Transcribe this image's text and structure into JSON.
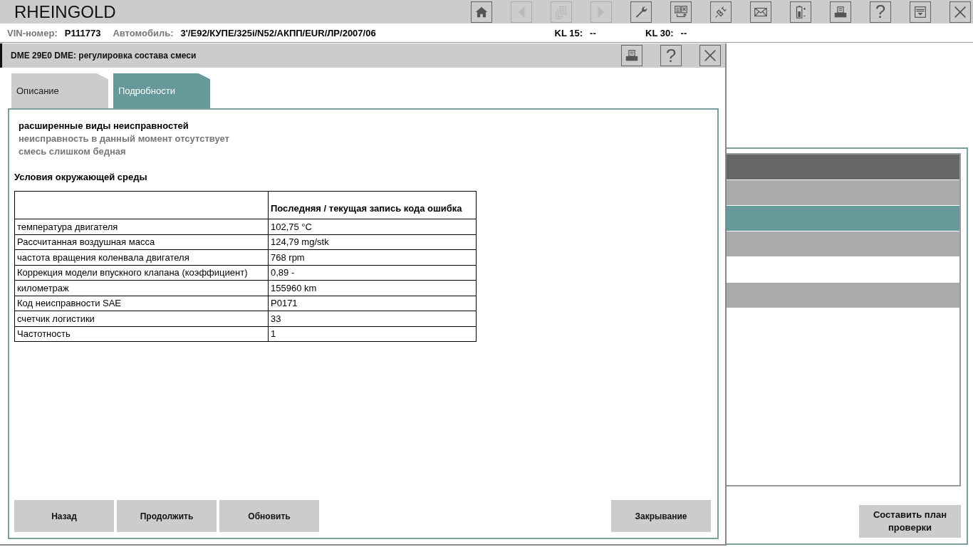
{
  "app": {
    "title": "RHEINGOLD"
  },
  "toolbar": [
    {
      "kind": "home",
      "disabled": false
    },
    {
      "kind": "back",
      "disabled": true
    },
    {
      "kind": "documents",
      "disabled": true
    },
    {
      "kind": "forward",
      "disabled": true
    },
    {
      "kind": "wrench",
      "disabled": false
    },
    {
      "kind": "swap",
      "disabled": false
    },
    {
      "kind": "plug",
      "disabled": false
    },
    {
      "kind": "envelope",
      "disabled": false
    },
    {
      "kind": "battery",
      "disabled": false
    },
    {
      "kind": "printer",
      "disabled": false
    },
    {
      "kind": "help",
      "label": "?",
      "disabled": false
    },
    {
      "kind": "dropdown",
      "disabled": false
    },
    {
      "kind": "close",
      "disabled": false
    }
  ],
  "vehicle_bar": {
    "vin_label": "VIN-номер:",
    "vin": "P111773",
    "car_label": "Автомобиль:",
    "car": "3'/E92/КУПЕ/325i/N52/АКПП/EUR/ЛР/2007/06",
    "kl15_label": "KL 15:",
    "kl15": "--",
    "kl30_label": "KL 30:",
    "kl30": "--"
  },
  "background_panel": {
    "rows": [
      {
        "color": "#666666"
      },
      {
        "color": "#aaaaaa"
      },
      {
        "color": "#669999"
      },
      {
        "color": "#aaaaaa"
      },
      {
        "color": "#aaaaaa"
      }
    ],
    "button": "Составить план проверки"
  },
  "dialog": {
    "title": "DME 29E0 DME: регулировка состава смеси",
    "title_buttons": [
      {
        "kind": "printer"
      },
      {
        "kind": "help",
        "label": "?"
      },
      {
        "kind": "close"
      }
    ],
    "tabs": [
      {
        "label": "Описание",
        "selected": false
      },
      {
        "label": "Подробности",
        "selected": true
      }
    ],
    "fault_types_heading": "расширенные виды неисправностей",
    "fault_types": [
      "неисправность в данный момент отсутствует",
      "смесь слишком бедная"
    ],
    "environment_heading": "Условия окружающей среды",
    "table": {
      "column_2_header": "Последняя / текущая запись кода ошибка",
      "rows": [
        [
          "температура двигателя",
          "102,75 °C"
        ],
        [
          "Рассчитанная воздушная масса",
          "124,79 mg/stk"
        ],
        [
          "частота вращения коленвала двигателя",
          "768 rpm"
        ],
        [
          "Коррекция модели впускного клапана (коэффициент)",
          "0,89 -"
        ],
        [
          "километраж",
          "155960 km"
        ],
        [
          "Код неисправности SAE",
          "P0171"
        ],
        [
          "счетчик логистики",
          "33"
        ],
        [
          "Частотность",
          "1"
        ]
      ]
    },
    "buttons_left": [
      "Назад",
      "Продолжить",
      "Обновить"
    ],
    "buttons_right": [
      "Закрывание"
    ]
  }
}
